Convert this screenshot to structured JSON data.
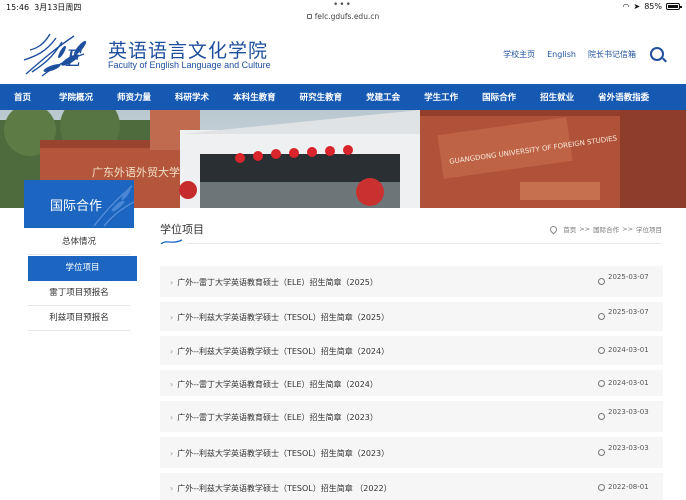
{
  "status": {
    "time": "15:46",
    "date": "3月13日周四",
    "battery": "85%",
    "url": "felc.gdufs.edu.cn"
  },
  "header": {
    "logo_cn": "英语语言文化学院",
    "logo_en": "Faculty of English Language and Culture",
    "links": [
      "学校主页",
      "English",
      "院长书记信箱"
    ]
  },
  "nav": [
    "首页",
    "学院概况",
    "师资力量",
    "科研学术",
    "本科生教育",
    "研究生教育",
    "党建工会",
    "学生工作",
    "国际合作",
    "招生就业",
    "省外语教指委"
  ],
  "banner": {
    "sign_text": "GUANGDONG UNIVERSITY OF FOREIGN STUDIES",
    "wall_text": "广东外语外贸大学"
  },
  "sidebar": {
    "heading": "国际合作",
    "items": [
      "总体情况",
      "学位项目",
      "雷丁项目预报名",
      "利兹项目预报名"
    ]
  },
  "content": {
    "title": "学位项目",
    "breadcrumb": [
      "首页",
      ">>",
      "国际合作",
      ">>",
      "学位项目"
    ],
    "rows": [
      {
        "title": "广外--雷丁大学英语教育硕士（ELE）招生简章（2025）",
        "date": "2025-03-07"
      },
      {
        "title": "广外--利兹大学英语教学硕士（TESOL）招生简章（2025）",
        "date": "2025-03-07"
      },
      {
        "title": "广外--利兹大学英语教学硕士（TESOL）招生简章（2024）",
        "date": "2024-03-01"
      },
      {
        "title": "广外--雷丁大学英语教育硕士（ELE）招生简章（2024）",
        "date": "2024-03-01"
      },
      {
        "title": "广外--雷丁大学英语教育硕士（ELE）招生简章（2023）",
        "date": "2023-03-03"
      },
      {
        "title": "广外--利兹大学英语教学硕士（TESOL）招生简章（2023）",
        "date": "2023-03-03"
      },
      {
        "title": "广外--利兹大学英语教学硕士（TESOL）招生简章 （2022）",
        "date": "2022-08-01"
      }
    ]
  },
  "colors": {
    "brand_blue": "#1659b3",
    "side_blue": "#1c66c2"
  }
}
